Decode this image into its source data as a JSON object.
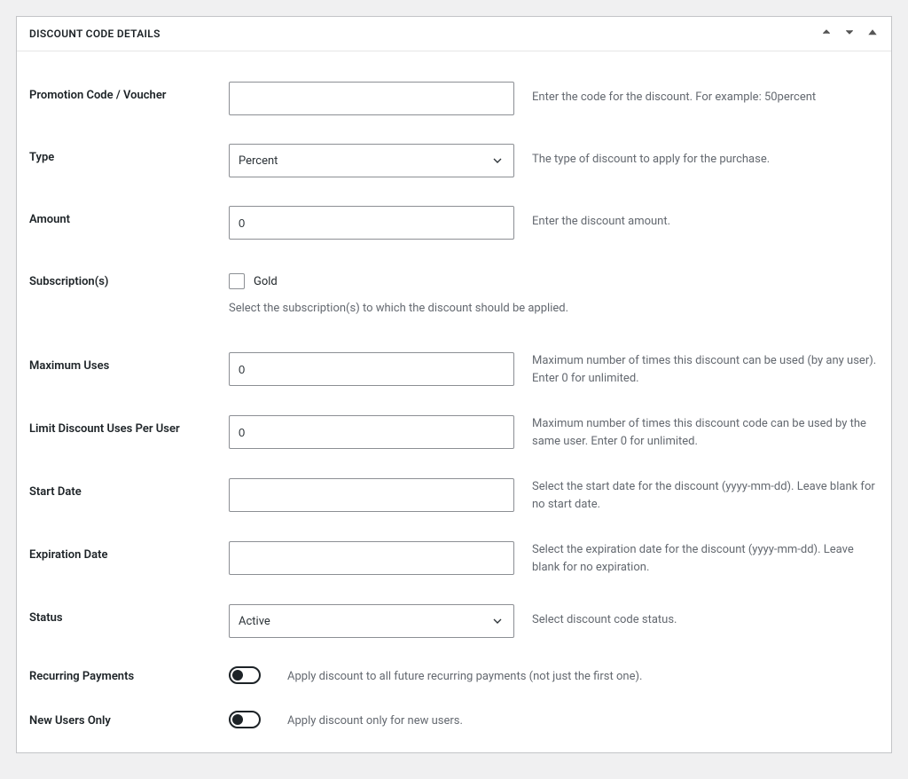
{
  "panel": {
    "title": "DISCOUNT CODE DETAILS"
  },
  "fields": {
    "promo_code": {
      "label": "Promotion Code / Voucher",
      "value": "",
      "help": "Enter the code for the discount. For example: 50percent"
    },
    "type": {
      "label": "Type",
      "selected": "Percent",
      "help": "The type of discount to apply for the purchase."
    },
    "amount": {
      "label": "Amount",
      "value": "0",
      "help": "Enter the discount amount."
    },
    "subscriptions": {
      "label": "Subscription(s)",
      "option_label": "Gold",
      "help_below": "Select the subscription(s) to which the discount should be applied."
    },
    "max_uses": {
      "label": "Maximum Uses",
      "value": "0",
      "help": "Maximum number of times this discount can be used (by any user). Enter 0 for unlimited."
    },
    "limit_per_user": {
      "label": "Limit Discount Uses Per User",
      "value": "0",
      "help": "Maximum number of times this discount code can be used by the same user. Enter 0 for unlimited."
    },
    "start_date": {
      "label": "Start Date",
      "value": "",
      "help": "Select the start date for the discount (yyyy-mm-dd). Leave blank for no start date."
    },
    "expiration_date": {
      "label": "Expiration Date",
      "value": "",
      "help": "Select the expiration date for the discount (yyyy-mm-dd). Leave blank for no expiration."
    },
    "status": {
      "label": "Status",
      "selected": "Active",
      "help": "Select discount code status."
    },
    "recurring": {
      "label": "Recurring Payments",
      "help": "Apply discount to all future recurring payments (not just the first one)."
    },
    "new_users": {
      "label": "New Users Only",
      "help": "Apply discount only for new users."
    }
  }
}
